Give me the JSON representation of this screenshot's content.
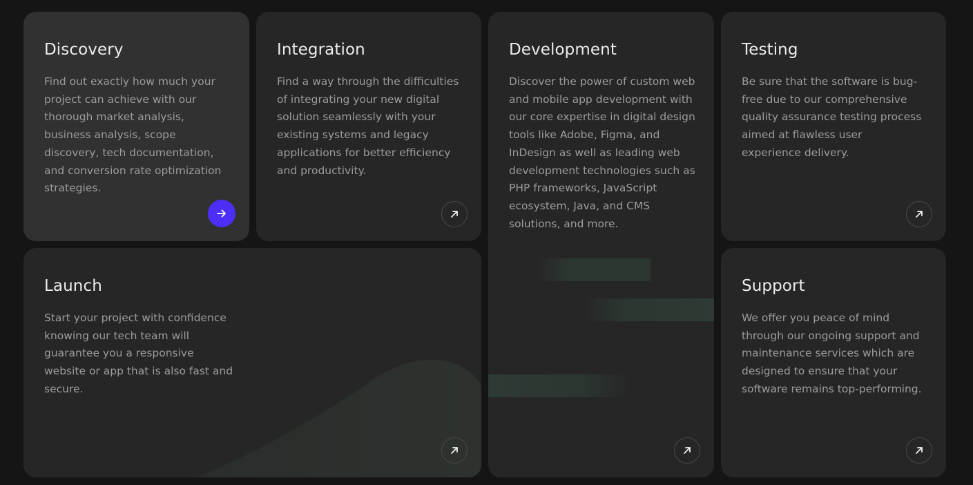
{
  "cards": [
    {
      "title": "Discovery",
      "text": "Find out exactly how much your project can achieve with our thorough market analysis, business analysis, scope discovery, tech documentation, and conversion rate optimization strategies.",
      "button_icon": "arrow-right-icon"
    },
    {
      "title": "Integration",
      "text": "Find a way through the difficulties of integrating your new digital solution seamlessly with your existing systems and legacy applications for better efficiency and productivity.",
      "button_icon": "arrow-up-right-icon"
    },
    {
      "title": "Development",
      "text": "Discover the power of custom web and mobile app development with our core expertise in digital design tools like Adobe, Figma, and InDesign as well as leading web development technologies such as PHP frameworks, JavaScript ecosystem, Java, and CMS solutions, and more.",
      "button_icon": "arrow-up-right-icon"
    },
    {
      "title": "Testing",
      "text": "Be sure that the software is bug-free due to our comprehensive quality assurance testing process aimed at flawless user experience delivery.",
      "button_icon": "arrow-up-right-icon"
    },
    {
      "title": "Launch",
      "text": "Start your project with confidence knowing our tech team will guarantee you a responsive website or app that is also fast and secure.",
      "button_icon": "arrow-up-right-icon"
    },
    {
      "title": "Support",
      "text": "We offer you peace of mind through our ongoing support and maintenance services which are designed to ensure that your software remains top-performing.",
      "button_icon": "arrow-up-right-icon"
    }
  ],
  "colors": {
    "page_background": "#151515",
    "card_background": "#262626",
    "active_card_background": "#313131",
    "accent": "#4c2ff6",
    "title": "#ececec",
    "body_text": "#9c9c9c"
  }
}
